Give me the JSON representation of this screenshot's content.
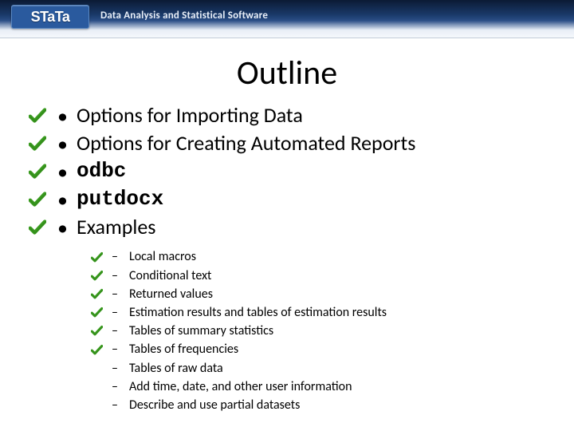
{
  "header": {
    "logo_text": "STaTa",
    "tagline": "Data Analysis and Statistical Software"
  },
  "title": "Outline",
  "main_items": [
    {
      "text": "Options for Importing Data",
      "mono": false,
      "checked": true
    },
    {
      "text": "Options for Creating Automated Reports",
      "mono": false,
      "checked": true
    },
    {
      "text": "odbc",
      "mono": true,
      "checked": true
    },
    {
      "text": "putdocx",
      "mono": true,
      "checked": true
    },
    {
      "text": "Examples",
      "mono": false,
      "checked": true
    }
  ],
  "sub_items": [
    {
      "text": "Local macros",
      "checked": true
    },
    {
      "text": "Conditional text",
      "checked": true
    },
    {
      "text": "Returned values",
      "checked": true
    },
    {
      "text": "Estimation results and tables of estimation results",
      "checked": true
    },
    {
      "text": "Tables of summary statistics",
      "checked": true
    },
    {
      "text": "Tables of frequencies",
      "checked": true
    },
    {
      "text": "Tables of raw data",
      "checked": false
    },
    {
      "text": "Add time, date, and other user information",
      "checked": false
    },
    {
      "text": "Describe and use partial datasets",
      "checked": false
    }
  ],
  "colors": {
    "check_green": "#3a9b1f",
    "check_shadow": "#2a7716"
  }
}
